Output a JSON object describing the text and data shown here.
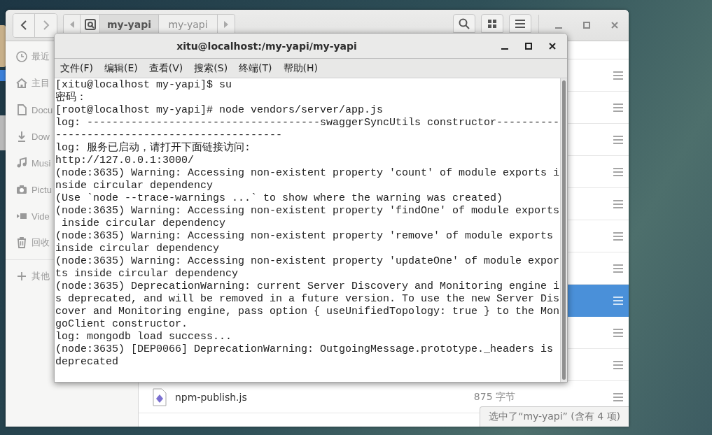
{
  "file_manager": {
    "path_bar": [
      {
        "label": "my-yapi",
        "selected": true
      },
      {
        "label": "my-yapi",
        "selected": false
      }
    ],
    "sidebar": {
      "items": [
        {
          "label": "最近"
        },
        {
          "label": "主目"
        },
        {
          "label": "Docu"
        },
        {
          "label": "Dow"
        },
        {
          "label": "Musi"
        },
        {
          "label": "Pictu"
        },
        {
          "label": "Vide"
        },
        {
          "label": "回收"
        }
      ],
      "other": {
        "label": "其他"
      }
    },
    "rows": [
      {
        "selected": false
      },
      {
        "selected": false
      },
      {
        "selected": false
      },
      {
        "selected": false
      },
      {
        "selected": false
      },
      {
        "selected": false
      },
      {
        "selected": false
      },
      {
        "selected": true
      },
      {
        "selected": false
      },
      {
        "selected": false
      },
      {
        "selected": false,
        "name": "npm-publish.js",
        "size": "875 字节"
      }
    ],
    "status": "选中了“my-yapi” (含有 4 项)"
  },
  "terminal": {
    "title": "xitu@localhost:/my-yapi/my-yapi",
    "menu": [
      "文件(F)",
      "编辑(E)",
      "查看(V)",
      "搜索(S)",
      "终端(T)",
      "帮助(H)"
    ],
    "lines": [
      "[xitu@localhost my-yapi]$ su",
      "密码：",
      "[root@localhost my-yapi]# node vendors/server/app.js",
      "log: -------------------------------------swaggerSyncUtils constructor----------",
      "------------------------------------",
      "log: 服务已启动，请打开下面链接访问:",
      "http://127.0.0.1:3000/",
      "(node:3635) Warning: Accessing non-existent property 'count' of module exports i",
      "nside circular dependency",
      "(Use `node --trace-warnings ...` to show where the warning was created)",
      "(node:3635) Warning: Accessing non-existent property 'findOne' of module exports",
      " inside circular dependency",
      "(node:3635) Warning: Accessing non-existent property 'remove' of module exports",
      "inside circular dependency",
      "(node:3635) Warning: Accessing non-existent property 'updateOne' of module expor",
      "ts inside circular dependency",
      "(node:3635) DeprecationWarning: current Server Discovery and Monitoring engine i",
      "s deprecated, and will be removed in a future version. To use the new Server Dis",
      "cover and Monitoring engine, pass option { useUnifiedTopology: true } to the Mon",
      "goClient constructor.",
      "log: mongodb load success...",
      "(node:3635) [DEP0066] DeprecationWarning: OutgoingMessage.prototype._headers is",
      "deprecated"
    ]
  }
}
